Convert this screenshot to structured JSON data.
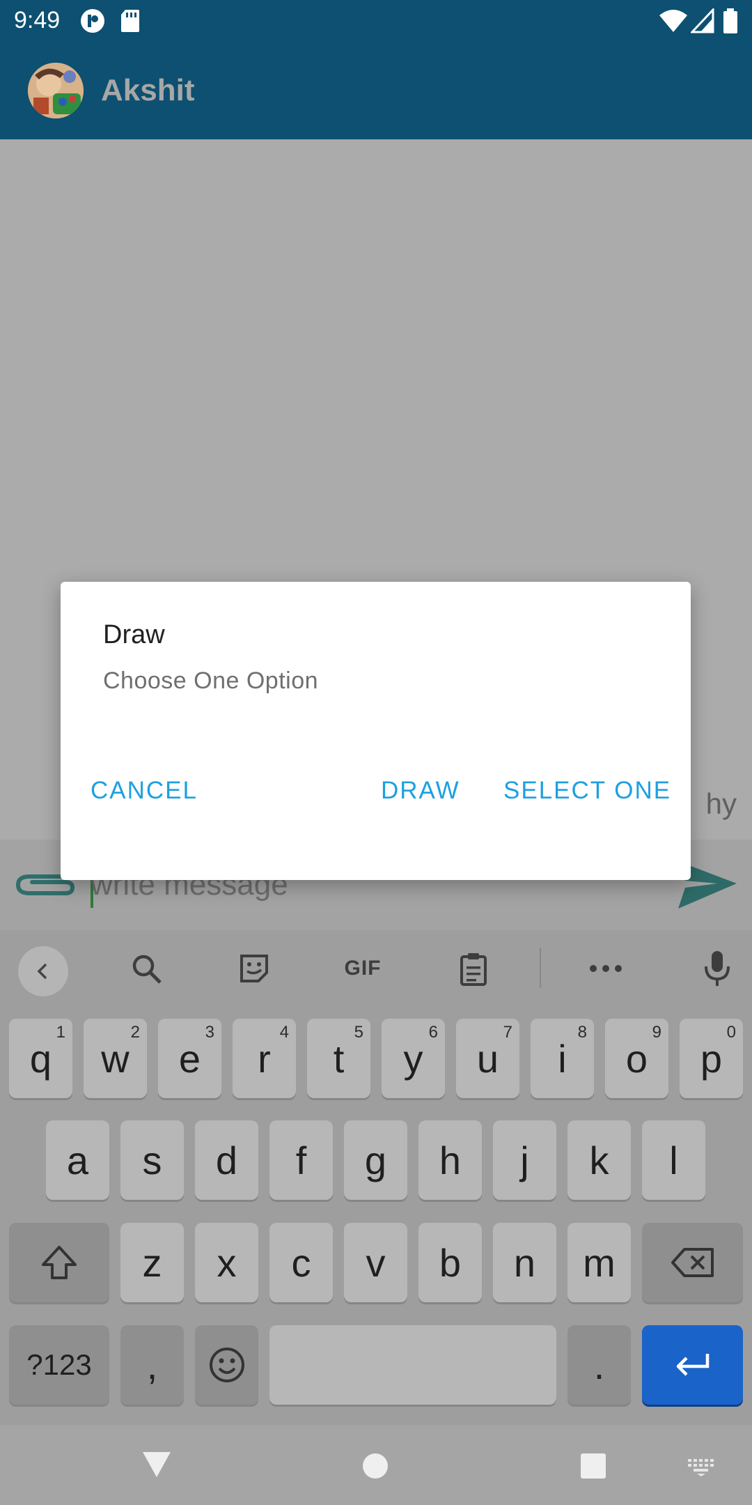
{
  "status_bar": {
    "time": "9:49"
  },
  "app_bar": {
    "contact_name": "Akshit"
  },
  "chat": {
    "incoming_message": "hy"
  },
  "composer": {
    "placeholder": "write message"
  },
  "keyboard": {
    "toolbar": [
      "back-icon",
      "search-icon",
      "sticker-icon",
      "GIF",
      "clipboard-icon",
      "more-icon",
      "mic-icon"
    ],
    "gif_label": "GIF",
    "row1": [
      {
        "key": "q",
        "hint": "1"
      },
      {
        "key": "w",
        "hint": "2"
      },
      {
        "key": "e",
        "hint": "3"
      },
      {
        "key": "r",
        "hint": "4"
      },
      {
        "key": "t",
        "hint": "5"
      },
      {
        "key": "y",
        "hint": "6"
      },
      {
        "key": "u",
        "hint": "7"
      },
      {
        "key": "i",
        "hint": "8"
      },
      {
        "key": "o",
        "hint": "9"
      },
      {
        "key": "p",
        "hint": "0"
      }
    ],
    "row2": [
      "a",
      "s",
      "d",
      "f",
      "g",
      "h",
      "j",
      "k",
      "l"
    ],
    "row3": [
      "z",
      "x",
      "c",
      "v",
      "b",
      "n",
      "m"
    ],
    "row4": {
      "symbols": "?123",
      "comma": ",",
      "period": "."
    }
  },
  "dialog": {
    "title": "Draw",
    "message": "Choose One Option",
    "cancel_label": "CANCEL",
    "draw_label": "DRAW",
    "select_label": "SELECT ONE"
  },
  "colors": {
    "app_bar": "#0d5071",
    "accent_button": "#1ea0e0",
    "enter_key": "#1a63c8",
    "send_icon": "#2e6b68"
  }
}
